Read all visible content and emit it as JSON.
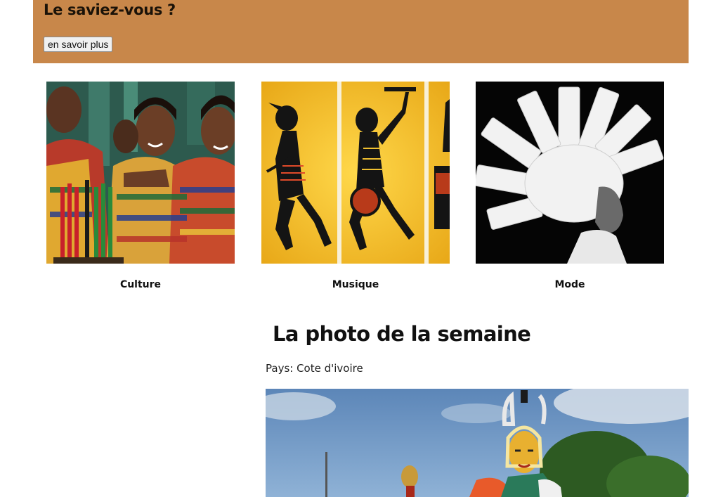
{
  "banner": {
    "title": "Le saviez-vous ?",
    "button_label": "en savoir plus",
    "color": "#c8874a"
  },
  "categories": [
    {
      "label": "Culture"
    },
    {
      "label": "Musique"
    },
    {
      "label": "Mode"
    }
  ],
  "week_photo": {
    "title": "La photo de la semaine",
    "country": "Pays: Cote d'ivoire"
  }
}
